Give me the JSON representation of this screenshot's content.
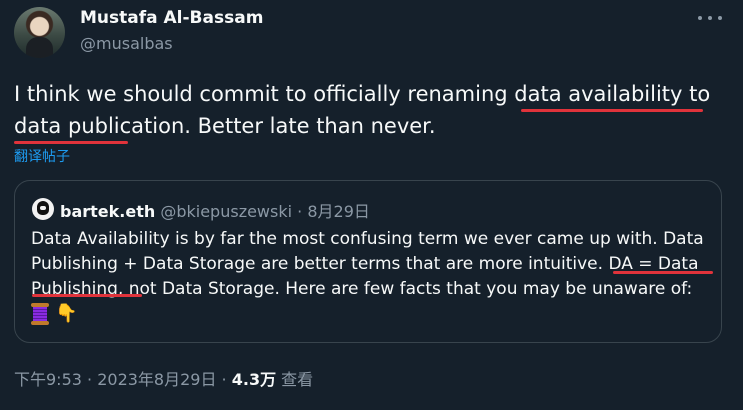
{
  "author": {
    "display_name": "Mustafa Al-Bassam",
    "handle": "@musalbas"
  },
  "tweet": {
    "text_part1": "I think we should commit to officially renaming data ",
    "text_highlight1": "availability to data",
    "text_highlight2": "publication",
    "text_part2": ". Better late than never.",
    "translate_label": "翻译帖子"
  },
  "quote": {
    "display_name": "bartek.eth",
    "handle": "@bkiepuszewski",
    "separator": " · ",
    "date": "8月29日",
    "text_part1": "Data Availability is by far the most confusing term we ever came up with. Data Publishing + Data Storage are better terms that are more intuitive. ",
    "text_highlight1": "DA = Data",
    "text_highlight2": "Publishing",
    "text_part2": ", not Data Storage. Here are few facts that you may be unaware of:",
    "emoji1": "thread-spool-icon",
    "emoji2": "👇"
  },
  "footer": {
    "time": "下午9:53",
    "sep1": " · ",
    "date": "2023年8月29日",
    "sep2": " · ",
    "views_count": "4.3万",
    "views_label": " 查看"
  },
  "colors": {
    "background": "#15202b",
    "text": "#f7f9f9",
    "muted": "#8b98a5",
    "link": "#1d9bf0",
    "annotation_underline": "#e0333b",
    "border": "#38444d"
  }
}
